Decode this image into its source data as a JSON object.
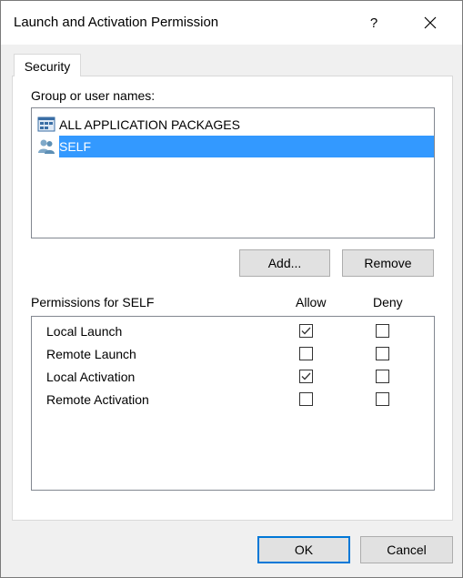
{
  "window": {
    "title": "Launch and Activation Permission",
    "help_glyph": "?"
  },
  "tabs": [
    {
      "label": "Security",
      "active": true
    }
  ],
  "group_section": {
    "label": "Group or user names:",
    "items": [
      {
        "label": "ALL APPLICATION PACKAGES",
        "icon": "app-packages-icon",
        "selected": false
      },
      {
        "label": "SELF",
        "icon": "users-icon",
        "selected": true
      }
    ],
    "add_label": "Add...",
    "remove_label": "Remove"
  },
  "permissions": {
    "label": "Permissions for SELF",
    "allow_header": "Allow",
    "deny_header": "Deny",
    "rows": [
      {
        "name": "Local Launch",
        "allow": true,
        "deny": false
      },
      {
        "name": "Remote Launch",
        "allow": false,
        "deny": false
      },
      {
        "name": "Local Activation",
        "allow": true,
        "deny": false
      },
      {
        "name": "Remote Activation",
        "allow": false,
        "deny": false
      }
    ]
  },
  "footer": {
    "ok_label": "OK",
    "cancel_label": "Cancel"
  },
  "colors": {
    "selection": "#3399ff",
    "default_button_border": "#0078d7",
    "button_face": "#e1e1e1"
  }
}
